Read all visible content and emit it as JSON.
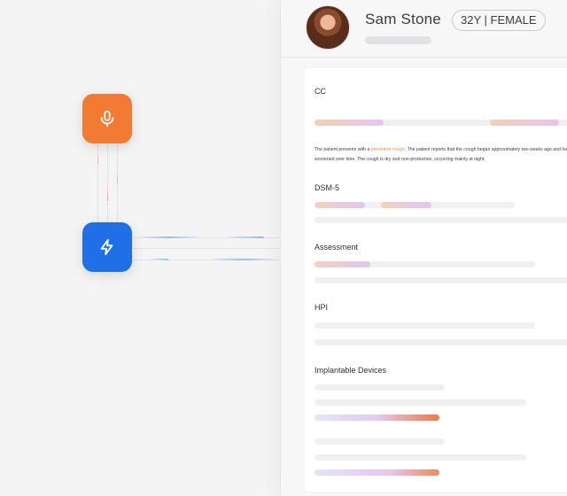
{
  "patient": {
    "name": "Sam Stone",
    "badge": "32Y | FEMALE"
  },
  "sections": {
    "cc": "CC",
    "dsm5": "DSM-5",
    "assessment": "Assessment",
    "hpi": "HPI",
    "implantable_devices": "Implantable Devices"
  },
  "note": {
    "before": "The patient presents with a ",
    "highlight": "persistent cough",
    "after": ". The patient reports that the cough began approximately two weeks ago and has worsened over time. The cough is dry and non-productive, occurring mainly at night."
  },
  "colors": {
    "mic_node": "#f27a33",
    "action_node": "#1f6fe6",
    "highlight_text": "#f08a50"
  },
  "icons": {
    "mic_node": "microphone-icon",
    "action_node": "lightning-bolt-icon"
  }
}
